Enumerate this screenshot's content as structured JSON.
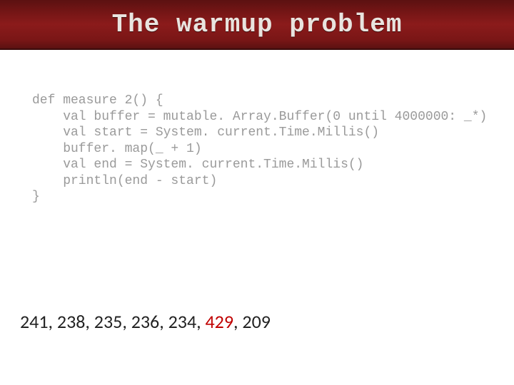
{
  "title": "The warmup problem",
  "code": {
    "l1": "def measure 2() {",
    "l2": "    val buffer = mutable. Array.Buffer(0 until 4000000: _*)",
    "l3": "    val start = System. current.Time.Millis()",
    "l4": "    buffer. map(_ + 1)",
    "l5": "    val end = System. current.Time.Millis()",
    "l6": "    println(end - start)",
    "l7": "}"
  },
  "results": {
    "prefix": "241, 238, 235, 236, 234, ",
    "highlight": "429",
    "suffix": ", 209"
  }
}
